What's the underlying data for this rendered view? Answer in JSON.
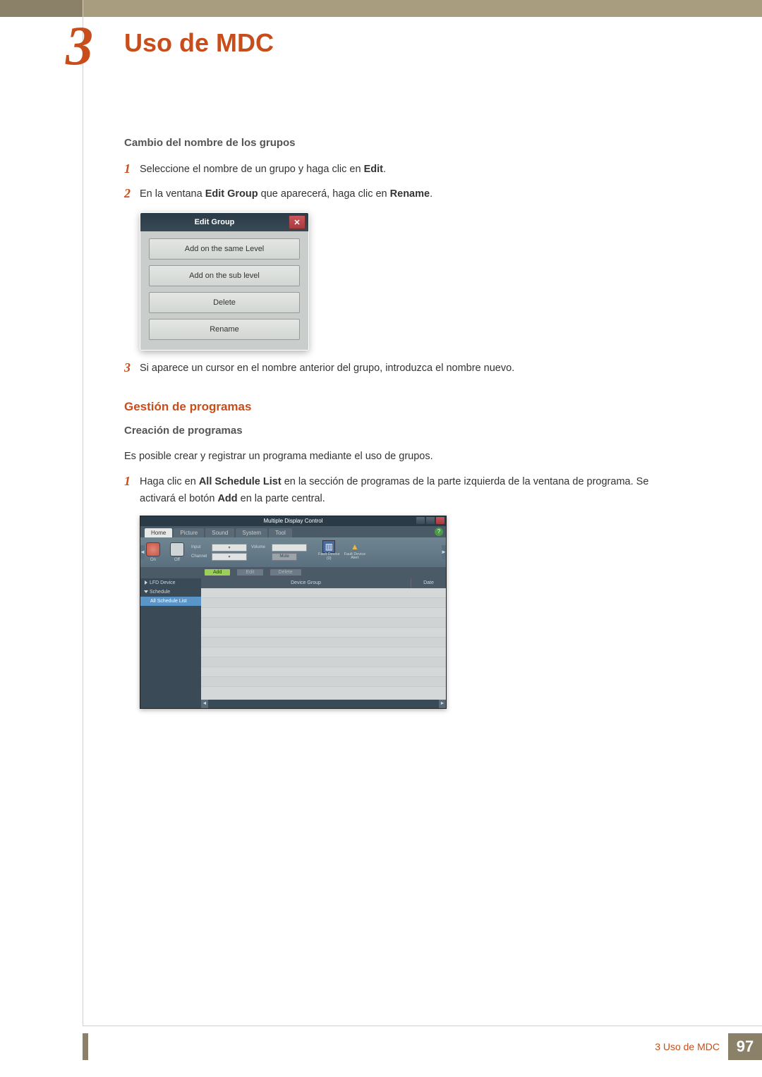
{
  "chapter": {
    "number": "3",
    "title": "Uso de MDC"
  },
  "section1": {
    "heading": "Cambio del nombre de los grupos",
    "steps": [
      {
        "num": "1",
        "text_a": "Seleccione el nombre de un grupo y haga clic en ",
        "bold_b": "Edit",
        "text_c": "."
      },
      {
        "num": "2",
        "text_a": "En la ventana ",
        "bold_b": "Edit Group",
        "text_c": " que aparecerá, haga clic en ",
        "bold_d": "Rename",
        "text_e": "."
      },
      {
        "num": "3",
        "text_a": "Si aparece un cursor en el nombre anterior del grupo, introduzca el nombre nuevo."
      }
    ]
  },
  "dialog": {
    "title": "Edit Group",
    "close": "✕",
    "buttons": [
      "Add on the same Level",
      "Add on the sub level",
      "Delete",
      "Rename"
    ]
  },
  "section2": {
    "heading": "Gestión de programas",
    "subheading": "Creación de programas",
    "intro": "Es posible crear y registrar un programa mediante el uso de grupos.",
    "step": {
      "num": "1",
      "text_a": "Haga clic en ",
      "bold_b": "All Schedule List",
      "text_c": " en la sección de programas de la parte izquierda de la ventana de programa. Se activará el botón ",
      "bold_d": "Add",
      "text_e": " en la parte central."
    }
  },
  "mdc": {
    "title": "Multiple Display Control",
    "help": "?",
    "tabs": [
      "Home",
      "Picture",
      "Sound",
      "System",
      "Tool"
    ],
    "ribbon": {
      "on": "On",
      "off": "Off",
      "input": "Input",
      "channel": "Channel",
      "volume": "Volume",
      "mute": "Mute",
      "fault_log": "Fault Device",
      "fault_log_n": "(0)",
      "fault_alert": "Fault Device",
      "fault_alert_sub": "Alert"
    },
    "toolbar": {
      "add": "Add",
      "edit": "Edit",
      "delete": "Delete"
    },
    "side": {
      "lfd": "LFD Device",
      "schedule": "Schedule",
      "all": "All Schedule List"
    },
    "grid": {
      "group": "Device Group",
      "date": "Date"
    }
  },
  "footer": {
    "label": "3 Uso de MDC",
    "page": "97"
  }
}
